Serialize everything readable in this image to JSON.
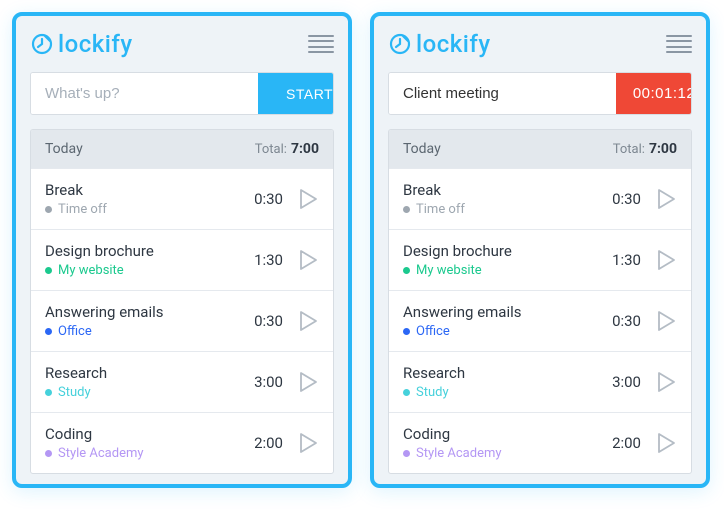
{
  "app_name": "lockify",
  "panels": [
    {
      "input_value": "",
      "placeholder": "What's up?",
      "action_label": "START",
      "action_type": "start",
      "timer": null
    },
    {
      "input_value": "Client meeting",
      "placeholder": "What's up?",
      "action_label": "00:01:12",
      "action_type": "stop",
      "timer": "00:01:12"
    }
  ],
  "list_header": {
    "day_label": "Today",
    "total_label": "Total:",
    "total_value": "7:00"
  },
  "entries": [
    {
      "title": "Break",
      "project": "Time off",
      "color": "#9ea7b0",
      "duration": "0:30"
    },
    {
      "title": "Design brochure",
      "project": "My website",
      "color": "#1bc98e",
      "duration": "1:30"
    },
    {
      "title": "Answering emails",
      "project": "Office",
      "color": "#2b67f5",
      "duration": "0:30"
    },
    {
      "title": "Research",
      "project": "Study",
      "color": "#46d1db",
      "duration": "3:00"
    },
    {
      "title": "Coding",
      "project": "Style Academy",
      "color": "#b497f4",
      "duration": "2:00"
    }
  ]
}
